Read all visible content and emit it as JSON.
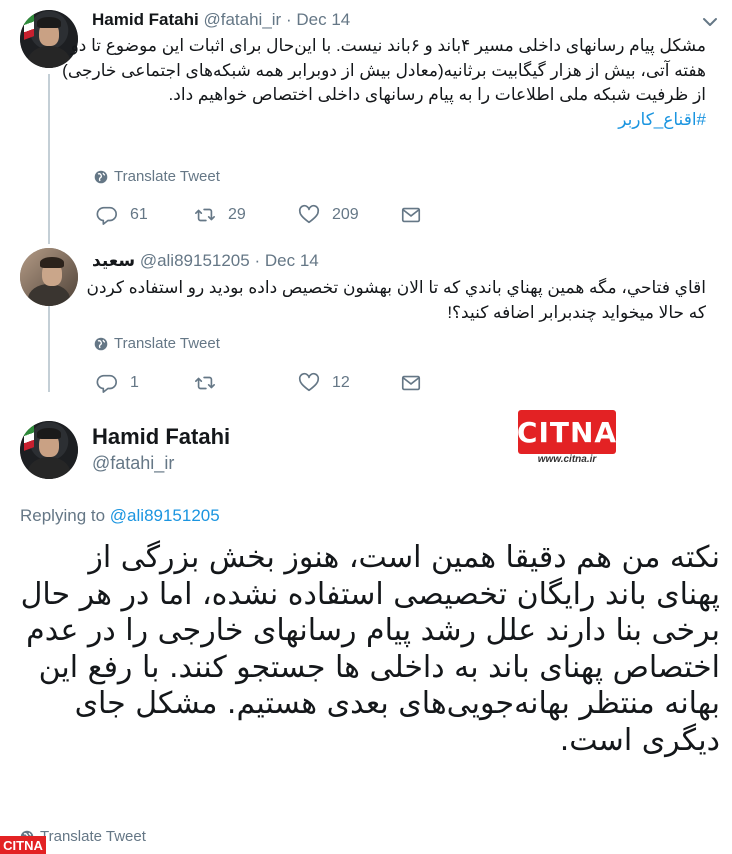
{
  "tweets": [
    {
      "name": "Hamid Fatahi",
      "handle": "@fatahi_ir",
      "dot": "·",
      "date": "Dec 14",
      "text": "مشکل پیام رسانهای داخلی مسیر ۴باند و ۶باند نیست. با این‌حال برای اثبات این موضوع تا دو هفته آتی، بیش از هزار گیگابیت برثانیه(معادل بیش از دوبرابر همه شبکه‌های اجتماعی خارجی) از ظرفیت شبکه ملی اطلاعات را به پیام رسانهای داخلی اختصاص خواهیم داد.",
      "hashtag": "#اقناع_کاربر",
      "translate": "Translate Tweet",
      "replies": "61",
      "retweets": "29",
      "likes": "209"
    },
    {
      "name": "سعید",
      "handle": "@ali89151205",
      "dot": "·",
      "date": "Dec 14",
      "text": "اقاي فتاحي، مگه همين پهناي باندي که تا الان بهشون تخصيص داده بوديد رو استفاده کردن که حالا ميخوايد چندبرابر اضافه کنيد؟!",
      "translate": "Translate Tweet",
      "replies": "1",
      "retweets": "",
      "likes": "12"
    }
  ],
  "main": {
    "name": "Hamid Fatahi",
    "handle": "@fatahi_ir",
    "replying_prefix": "Replying to",
    "replying_to": "@ali89151205",
    "text": "نکته من هم دقیقا همین است، هنوز بخش بزرگی از پهنای باند رایگان تخصیصی استفاده نشده، اما در هر حال برخی بنا دارند علل رشد پیام رسانهای خارجی را در عدم اختصاص پهنای باند به داخلی ها جستجو کنند. با رفع این بهانه منتظر بهانه‌جویی‌های بعدی هستیم. مشکل جای دیگری است.",
    "translate": "Translate Tweet"
  },
  "watermark": {
    "logo_text": "CITNA",
    "url": "www.citna.ir",
    "mini": "CITNA"
  },
  "colors": {
    "link": "#1b95e0",
    "muted": "#657786",
    "brand_red": "#e32224"
  },
  "icons": [
    "chevron-down-icon",
    "globe-icon",
    "reply-icon",
    "retweet-icon",
    "heart-icon",
    "message-icon"
  ]
}
